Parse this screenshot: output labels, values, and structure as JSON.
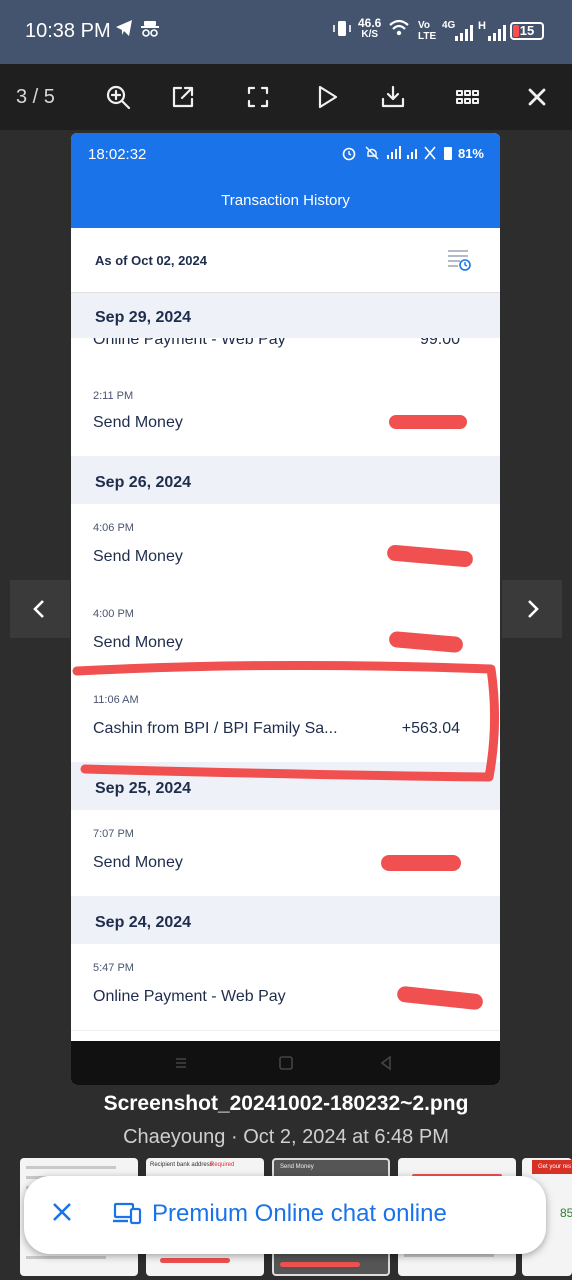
{
  "status_bar": {
    "time": "10:38 PM",
    "net_speed": "46.6",
    "net_unit": "K/S",
    "volte_top": "Vo",
    "volte_bottom": "LTE",
    "lte": "4G",
    "hplus": "H",
    "battery": "15"
  },
  "viewer": {
    "counter": "3 / 5",
    "filename": "Screenshot_20241002-180232~2.png",
    "meta": "Chaeyoung · Oct 2, 2024 at 6:48 PM"
  },
  "screenshot": {
    "time": "18:02:32",
    "battery": "81%",
    "title": "Transaction History",
    "as_of": "As of Oct 02, 2024",
    "partial_text": "Online Payment - Web Pay",
    "partial_amount": "99.00",
    "days": [
      {
        "date": "Sep 29, 2024"
      },
      {
        "date": "Sep 26, 2024"
      },
      {
        "date": "Sep 25, 2024"
      },
      {
        "date": "Sep 24, 2024"
      }
    ],
    "transactions": [
      {
        "time": "2:11 PM",
        "desc": "Send Money",
        "amount": ""
      },
      {
        "time": "4:06 PM",
        "desc": "Send Money",
        "amount": ""
      },
      {
        "time": "4:00 PM",
        "desc": "Send Money",
        "amount": ""
      },
      {
        "time": "11:06 AM",
        "desc": "Cashin from BPI / BPI Family Sa...",
        "amount": "+563.04"
      },
      {
        "time": "7:07 PM",
        "desc": "Send Money",
        "amount": ""
      },
      {
        "time": "5:47 PM",
        "desc": "Online Payment - Web Pay",
        "amount": ""
      }
    ]
  },
  "banner": {
    "text": "Premium Online chat online"
  },
  "thumbnails": {
    "t2_label": "Recipient bank address",
    "t2_required": "Required",
    "t3_label": "Send Money",
    "t5_button": "Get your res",
    "t6_text": "85"
  },
  "colors": {
    "accent_blue": "#1a73e8",
    "redact_red": "#f05050",
    "status_bar": "#44546e"
  }
}
